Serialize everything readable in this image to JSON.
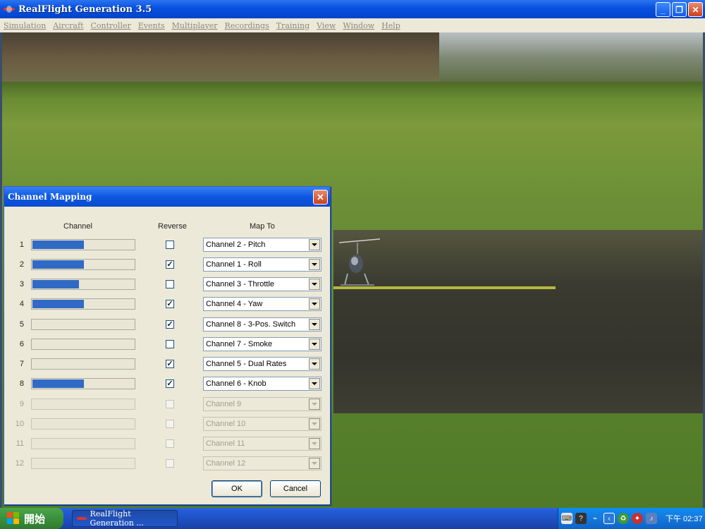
{
  "window": {
    "title": "RealFlight Generation 3.5",
    "controls": {
      "minimize": "_",
      "restore": "❐",
      "close": "✕"
    }
  },
  "menubar": {
    "items": [
      "Simulation",
      "Aircraft",
      "Controller",
      "Events",
      "Multiplayer",
      "Recordings",
      "Training",
      "View",
      "Window",
      "Help"
    ]
  },
  "dialog": {
    "title": "Channel Mapping",
    "close_glyph": "✕",
    "headers": {
      "channel": "Channel",
      "reverse": "Reverse",
      "map_to": "Map To"
    },
    "rows": [
      {
        "num": "1",
        "level": 0.5,
        "reverse": false,
        "map": "Channel 2 - Pitch",
        "enabled": true
      },
      {
        "num": "2",
        "level": 0.5,
        "reverse": true,
        "map": "Channel 1 - Roll",
        "enabled": true
      },
      {
        "num": "3",
        "level": 0.45,
        "reverse": false,
        "map": "Channel 3 - Throttle",
        "enabled": true
      },
      {
        "num": "4",
        "level": 0.5,
        "reverse": true,
        "map": "Channel 4 - Yaw",
        "enabled": true
      },
      {
        "num": "5",
        "level": 0.0,
        "reverse": true,
        "map": "Channel 8 - 3-Pos. Switch",
        "enabled": true
      },
      {
        "num": "6",
        "level": 0.0,
        "reverse": false,
        "map": "Channel 7 - Smoke",
        "enabled": true
      },
      {
        "num": "7",
        "level": 0.0,
        "reverse": true,
        "map": "Channel 5 - Dual Rates",
        "enabled": true
      },
      {
        "num": "8",
        "level": 0.5,
        "reverse": true,
        "map": "Channel 6 - Knob",
        "enabled": true
      },
      {
        "num": "9",
        "level": 0.0,
        "reverse": false,
        "map": "Channel 9",
        "enabled": false
      },
      {
        "num": "10",
        "level": 0.0,
        "reverse": false,
        "map": "Channel 10",
        "enabled": false
      },
      {
        "num": "11",
        "level": 0.0,
        "reverse": false,
        "map": "Channel 11",
        "enabled": false
      },
      {
        "num": "12",
        "level": 0.0,
        "reverse": false,
        "map": "Channel 12",
        "enabled": false
      }
    ],
    "ok_label": "OK",
    "cancel_label": "Cancel"
  },
  "taskbar": {
    "start_label": "開始",
    "task_label": "RealFlight Generation ...",
    "clock": "下午 02:37"
  },
  "colors": {
    "bar_fill": "#316ac5",
    "title_blue": "#0a53e0",
    "dialog_bg": "#ece9d8"
  }
}
